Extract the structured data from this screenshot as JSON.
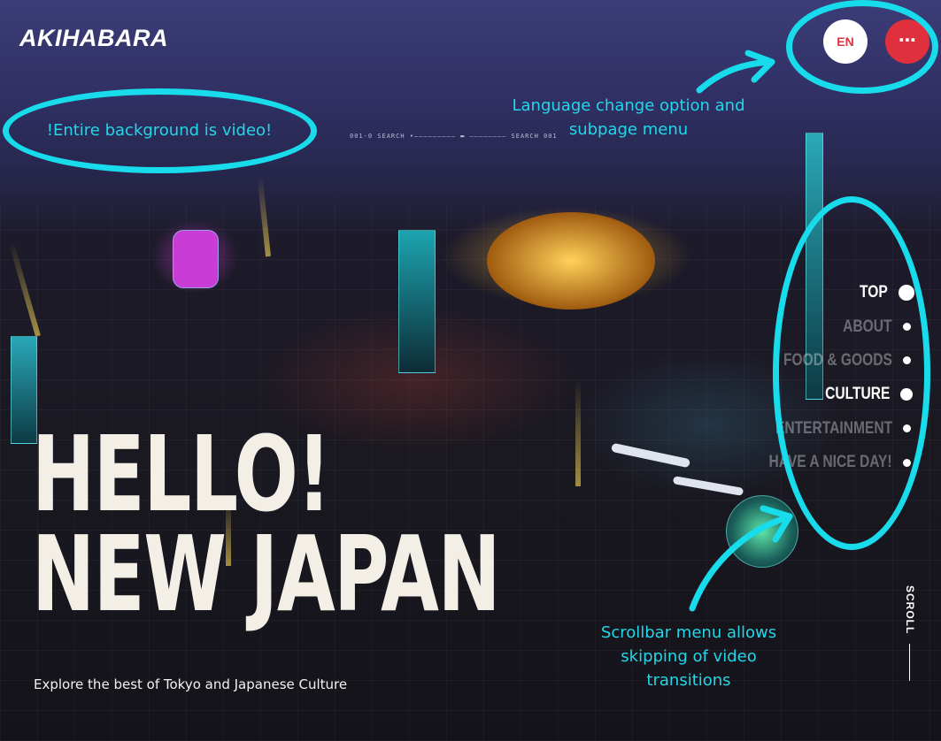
{
  "header": {
    "logo": "AKIHABARA",
    "language_button": "EN",
    "menu_button": "⋯",
    "lang_btn_color": "#d9353f",
    "menu_btn_color": "#e0303d"
  },
  "hero": {
    "line1": "HELLO!",
    "line2": "NEW JAPAN",
    "tagline": "Explore the best of Tokyo and Japanese Culture"
  },
  "hud": {
    "text": "001-0 SEARCH •————————— ▬ ———————— SEARCH 001"
  },
  "scrollbar_nav": {
    "items": [
      {
        "label": "TOP",
        "active": true
      },
      {
        "label": "ABOUT",
        "active": false
      },
      {
        "label": "FOOD & GOODS",
        "active": false
      },
      {
        "label": "CULTURE",
        "active": true
      },
      {
        "label": "ENTERTAINMENT",
        "active": false
      },
      {
        "label": "HAVE A NICE DAY!",
        "active": false
      }
    ]
  },
  "scroll_indicator": "SCROLL",
  "annotations": {
    "background_note": "!Entire background is video!",
    "language_note": "Language change option and subpage menu",
    "scrollbar_note": "Scrollbar menu allows skipping of video transitions",
    "accent_color": "#18dcec"
  }
}
